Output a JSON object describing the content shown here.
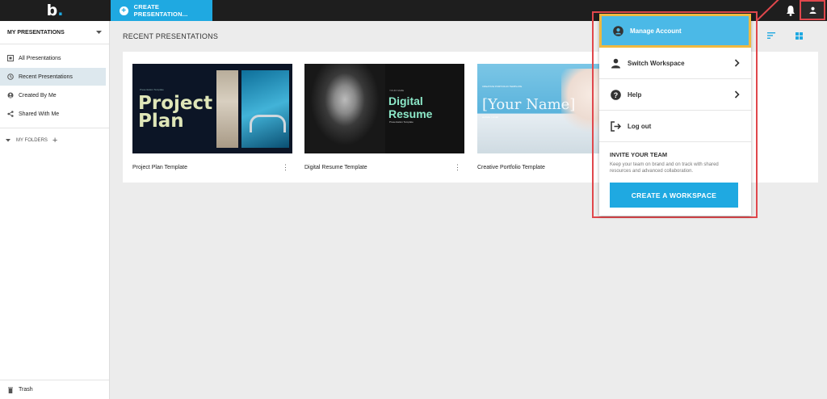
{
  "app": {
    "logo": "b",
    "logo_dot": "."
  },
  "topbar": {
    "create_label": "CREATE PRESENTATION..."
  },
  "sidebar": {
    "header": "MY PRESENTATIONS",
    "items": [
      {
        "label": "All Presentations",
        "icon": "presentation-icon"
      },
      {
        "label": "Recent Presentations",
        "icon": "history-icon",
        "active": true
      },
      {
        "label": "Created By Me",
        "icon": "person-icon"
      },
      {
        "label": "Shared With Me",
        "icon": "share-icon"
      }
    ],
    "folders_label": "MY FOLDERS",
    "trash_label": "Trash"
  },
  "main": {
    "title": "RECENT PRESENTATIONS",
    "cards": [
      {
        "title": "Project Plan Template",
        "thumb_small": "Presentation Template",
        "thumb_big": "Project Plan"
      },
      {
        "title": "Digital Resume Template",
        "thumb_small": "YOUR NAME",
        "thumb_big": "Digital Resume",
        "thumb_sub": "Presentation Template"
      },
      {
        "title": "Creative Portfolio Template",
        "thumb_small": "CREATIVE PORTFOLIO TEMPLATE",
        "thumb_big": "[Your Name]",
        "thumb_sub": "website | email"
      }
    ]
  },
  "menu": {
    "items": [
      {
        "label": "Manage Account",
        "icon": "account-circle-icon"
      },
      {
        "label": "Switch Workspace",
        "icon": "person-icon"
      },
      {
        "label": "Help",
        "icon": "help-icon"
      },
      {
        "label": "Log out",
        "icon": "logout-icon"
      }
    ],
    "invite_heading": "INVITE YOUR TEAM",
    "invite_text": "Keep your team on brand and on track with shared resources and advanced collaboration.",
    "workspace_button": "CREATE A WORKSPACE"
  },
  "colors": {
    "accent": "#1fa9e1",
    "annotation": "#e0474c",
    "highlight_border": "#f0b940",
    "topbar": "#1e1e1e"
  }
}
